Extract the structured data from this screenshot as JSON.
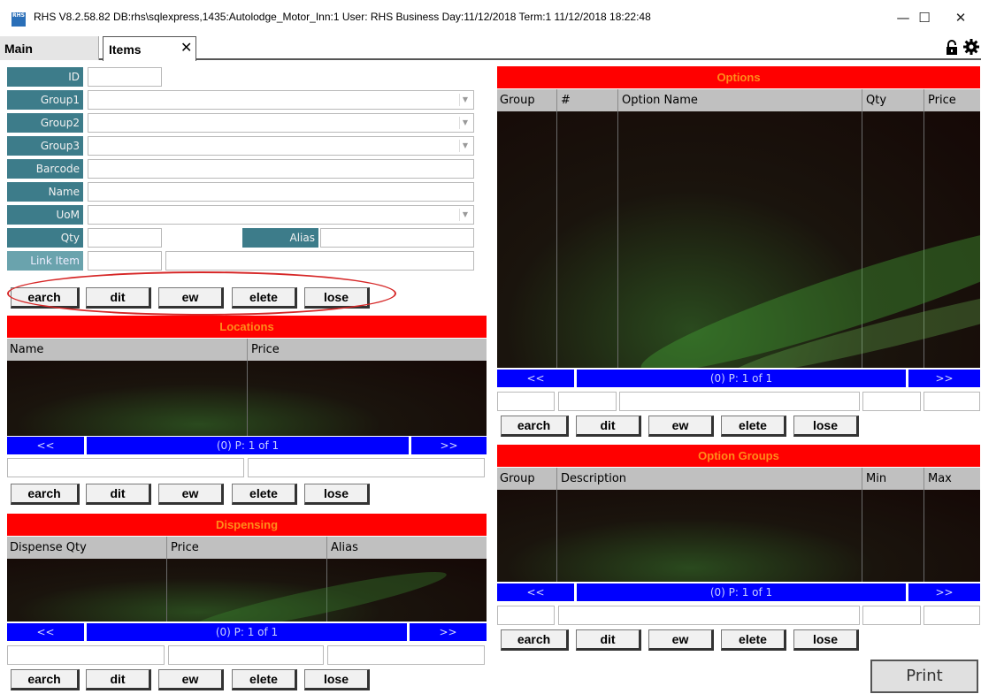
{
  "window": {
    "title": "RHS V8.2.58.82  DB:rhs\\sqlexpress,1435:Autolodge_Motor_Inn:1   User: RHS     Business Day:11/12/2018  Term:1  11/12/2018 18:22:48",
    "minimize": "—",
    "maximize": "☐",
    "close": "✕",
    "app_icon_text": "RHS"
  },
  "tabs": [
    {
      "label": "Main"
    },
    {
      "label": "Items"
    }
  ],
  "tab_close": "✕",
  "form": {
    "id_label": "ID",
    "group1_label": "Group1",
    "group2_label": "Group2",
    "group3_label": "Group3",
    "barcode_label": "Barcode",
    "name_label": "Name",
    "uom_label": "UoM",
    "qty_label": "Qty",
    "alias_label": "Alias",
    "link_item_label": "Link Item"
  },
  "buttons": {
    "search": "earch",
    "edit": "dit",
    "new": "ew",
    "delete": "elete",
    "close": "lose"
  },
  "locations": {
    "title": "Locations",
    "columns": [
      "Name",
      "Price"
    ],
    "nav": {
      "prev": "<<",
      "page": "(0) P: 1 of 1",
      "next": ">>"
    }
  },
  "dispensing": {
    "title": "Dispensing",
    "columns": [
      "Dispense Qty",
      "Price",
      "Alias"
    ],
    "nav": {
      "prev": "<<",
      "page": "(0) P: 1 of 1",
      "next": ">>"
    }
  },
  "options": {
    "title": "Options",
    "columns": [
      "Group",
      "#",
      "Option Name",
      "Qty",
      "Price"
    ],
    "nav": {
      "prev": "<<",
      "page": "(0) P: 1 of 1",
      "next": ">>"
    }
  },
  "option_groups": {
    "title": "Option Groups",
    "columns": [
      "Group",
      "Description",
      "Min",
      "Max"
    ],
    "nav": {
      "prev": "<<",
      "page": "(0) P: 1 of 1",
      "next": ">>"
    }
  },
  "print_label": "Print",
  "colors": {
    "header_red": "#ff0000",
    "nav_blue": "#0000ff",
    "label_teal": "#3d7c8a",
    "annotation_red": "#d62727"
  }
}
